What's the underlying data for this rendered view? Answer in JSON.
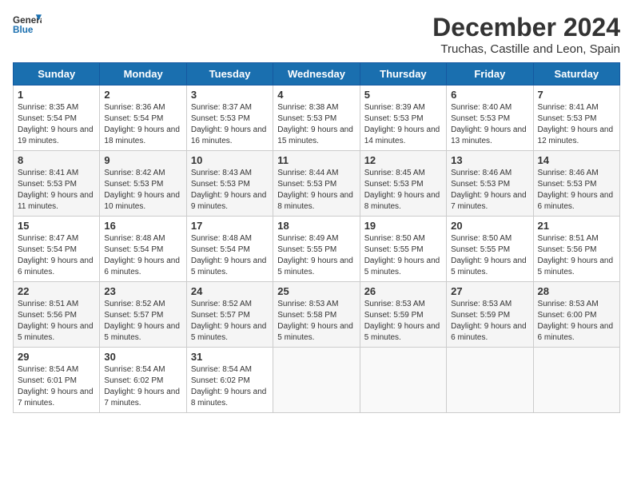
{
  "header": {
    "logo_line1": "General",
    "logo_line2": "Blue",
    "month_title": "December 2024",
    "location": "Truchas, Castille and Leon, Spain"
  },
  "weekdays": [
    "Sunday",
    "Monday",
    "Tuesday",
    "Wednesday",
    "Thursday",
    "Friday",
    "Saturday"
  ],
  "weeks": [
    [
      {
        "day": "1",
        "sunrise": "Sunrise: 8:35 AM",
        "sunset": "Sunset: 5:54 PM",
        "daylight": "Daylight: 9 hours and 19 minutes."
      },
      {
        "day": "2",
        "sunrise": "Sunrise: 8:36 AM",
        "sunset": "Sunset: 5:54 PM",
        "daylight": "Daylight: 9 hours and 18 minutes."
      },
      {
        "day": "3",
        "sunrise": "Sunrise: 8:37 AM",
        "sunset": "Sunset: 5:53 PM",
        "daylight": "Daylight: 9 hours and 16 minutes."
      },
      {
        "day": "4",
        "sunrise": "Sunrise: 8:38 AM",
        "sunset": "Sunset: 5:53 PM",
        "daylight": "Daylight: 9 hours and 15 minutes."
      },
      {
        "day": "5",
        "sunrise": "Sunrise: 8:39 AM",
        "sunset": "Sunset: 5:53 PM",
        "daylight": "Daylight: 9 hours and 14 minutes."
      },
      {
        "day": "6",
        "sunrise": "Sunrise: 8:40 AM",
        "sunset": "Sunset: 5:53 PM",
        "daylight": "Daylight: 9 hours and 13 minutes."
      },
      {
        "day": "7",
        "sunrise": "Sunrise: 8:41 AM",
        "sunset": "Sunset: 5:53 PM",
        "daylight": "Daylight: 9 hours and 12 minutes."
      }
    ],
    [
      {
        "day": "8",
        "sunrise": "Sunrise: 8:41 AM",
        "sunset": "Sunset: 5:53 PM",
        "daylight": "Daylight: 9 hours and 11 minutes."
      },
      {
        "day": "9",
        "sunrise": "Sunrise: 8:42 AM",
        "sunset": "Sunset: 5:53 PM",
        "daylight": "Daylight: 9 hours and 10 minutes."
      },
      {
        "day": "10",
        "sunrise": "Sunrise: 8:43 AM",
        "sunset": "Sunset: 5:53 PM",
        "daylight": "Daylight: 9 hours and 9 minutes."
      },
      {
        "day": "11",
        "sunrise": "Sunrise: 8:44 AM",
        "sunset": "Sunset: 5:53 PM",
        "daylight": "Daylight: 9 hours and 8 minutes."
      },
      {
        "day": "12",
        "sunrise": "Sunrise: 8:45 AM",
        "sunset": "Sunset: 5:53 PM",
        "daylight": "Daylight: 9 hours and 8 minutes."
      },
      {
        "day": "13",
        "sunrise": "Sunrise: 8:46 AM",
        "sunset": "Sunset: 5:53 PM",
        "daylight": "Daylight: 9 hours and 7 minutes."
      },
      {
        "day": "14",
        "sunrise": "Sunrise: 8:46 AM",
        "sunset": "Sunset: 5:53 PM",
        "daylight": "Daylight: 9 hours and 6 minutes."
      }
    ],
    [
      {
        "day": "15",
        "sunrise": "Sunrise: 8:47 AM",
        "sunset": "Sunset: 5:54 PM",
        "daylight": "Daylight: 9 hours and 6 minutes."
      },
      {
        "day": "16",
        "sunrise": "Sunrise: 8:48 AM",
        "sunset": "Sunset: 5:54 PM",
        "daylight": "Daylight: 9 hours and 6 minutes."
      },
      {
        "day": "17",
        "sunrise": "Sunrise: 8:48 AM",
        "sunset": "Sunset: 5:54 PM",
        "daylight": "Daylight: 9 hours and 5 minutes."
      },
      {
        "day": "18",
        "sunrise": "Sunrise: 8:49 AM",
        "sunset": "Sunset: 5:55 PM",
        "daylight": "Daylight: 9 hours and 5 minutes."
      },
      {
        "day": "19",
        "sunrise": "Sunrise: 8:50 AM",
        "sunset": "Sunset: 5:55 PM",
        "daylight": "Daylight: 9 hours and 5 minutes."
      },
      {
        "day": "20",
        "sunrise": "Sunrise: 8:50 AM",
        "sunset": "Sunset: 5:55 PM",
        "daylight": "Daylight: 9 hours and 5 minutes."
      },
      {
        "day": "21",
        "sunrise": "Sunrise: 8:51 AM",
        "sunset": "Sunset: 5:56 PM",
        "daylight": "Daylight: 9 hours and 5 minutes."
      }
    ],
    [
      {
        "day": "22",
        "sunrise": "Sunrise: 8:51 AM",
        "sunset": "Sunset: 5:56 PM",
        "daylight": "Daylight: 9 hours and 5 minutes."
      },
      {
        "day": "23",
        "sunrise": "Sunrise: 8:52 AM",
        "sunset": "Sunset: 5:57 PM",
        "daylight": "Daylight: 9 hours and 5 minutes."
      },
      {
        "day": "24",
        "sunrise": "Sunrise: 8:52 AM",
        "sunset": "Sunset: 5:57 PM",
        "daylight": "Daylight: 9 hours and 5 minutes."
      },
      {
        "day": "25",
        "sunrise": "Sunrise: 8:53 AM",
        "sunset": "Sunset: 5:58 PM",
        "daylight": "Daylight: 9 hours and 5 minutes."
      },
      {
        "day": "26",
        "sunrise": "Sunrise: 8:53 AM",
        "sunset": "Sunset: 5:59 PM",
        "daylight": "Daylight: 9 hours and 5 minutes."
      },
      {
        "day": "27",
        "sunrise": "Sunrise: 8:53 AM",
        "sunset": "Sunset: 5:59 PM",
        "daylight": "Daylight: 9 hours and 6 minutes."
      },
      {
        "day": "28",
        "sunrise": "Sunrise: 8:53 AM",
        "sunset": "Sunset: 6:00 PM",
        "daylight": "Daylight: 9 hours and 6 minutes."
      }
    ],
    [
      {
        "day": "29",
        "sunrise": "Sunrise: 8:54 AM",
        "sunset": "Sunset: 6:01 PM",
        "daylight": "Daylight: 9 hours and 7 minutes."
      },
      {
        "day": "30",
        "sunrise": "Sunrise: 8:54 AM",
        "sunset": "Sunset: 6:02 PM",
        "daylight": "Daylight: 9 hours and 7 minutes."
      },
      {
        "day": "31",
        "sunrise": "Sunrise: 8:54 AM",
        "sunset": "Sunset: 6:02 PM",
        "daylight": "Daylight: 9 hours and 8 minutes."
      },
      null,
      null,
      null,
      null
    ]
  ]
}
